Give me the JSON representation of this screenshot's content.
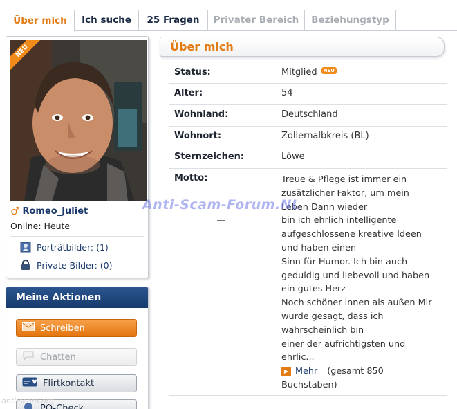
{
  "tabs": [
    {
      "label": "Über mich",
      "state": "active"
    },
    {
      "label": "Ich suche",
      "state": "normal"
    },
    {
      "label": "25 Fragen",
      "state": "normal"
    },
    {
      "label": "Privater Bereich",
      "state": "disabled"
    },
    {
      "label": "Beziehungstyp",
      "state": "disabled"
    }
  ],
  "profile": {
    "neu_label": "NEU",
    "gender_symbol": "♂",
    "username": "Romeo_Juliet",
    "online": "Online: Heute",
    "portrait_link": "Porträtbilder: (1)",
    "private_link": "Private Bilder: (0)"
  },
  "actions": {
    "title": "Meine Aktionen",
    "write": "Schreiben",
    "chat": "Chatten",
    "flirt": "Flirtkontakt",
    "check": "PQ-Check"
  },
  "about": {
    "title": "Über mich",
    "rows": [
      {
        "label": "Status:",
        "value": "Mitglied",
        "badge": "NEU"
      },
      {
        "label": "Alter:",
        "value": "54"
      },
      {
        "label": "Wohnland:",
        "value": "Deutschland"
      },
      {
        "label": "Wohnort:",
        "value": "Zollernalbkreis (BL)"
      },
      {
        "label": "Sternzeichen:",
        "value": "Löwe"
      }
    ],
    "motto_label": "Motto:",
    "motto_lines": [
      "Treue & Pflege ist immer ein",
      "zusätzlicher Faktor, um mein",
      "Leben Dann wieder",
      "bin ich ehrlich intelligente",
      "aufgeschlossene kreative Ideen",
      "und haben einen",
      "Sinn für Humor. Ich bin auch",
      "geduldig und liebevoll und haben",
      "ein gutes Herz",
      "Noch schöner innen als außen Mir",
      "wurde gesagt, dass ich",
      "wahrscheinlich bin",
      "einer der aufrichtigsten und",
      "ehrlic..."
    ],
    "more_label": "Mehr",
    "more_total": "(gesamt 850",
    "more_total2": "Buchstaben)"
  },
  "watermark": "Anti-Scam-Forum.NL",
  "watermark2": "anti-scam.org"
}
